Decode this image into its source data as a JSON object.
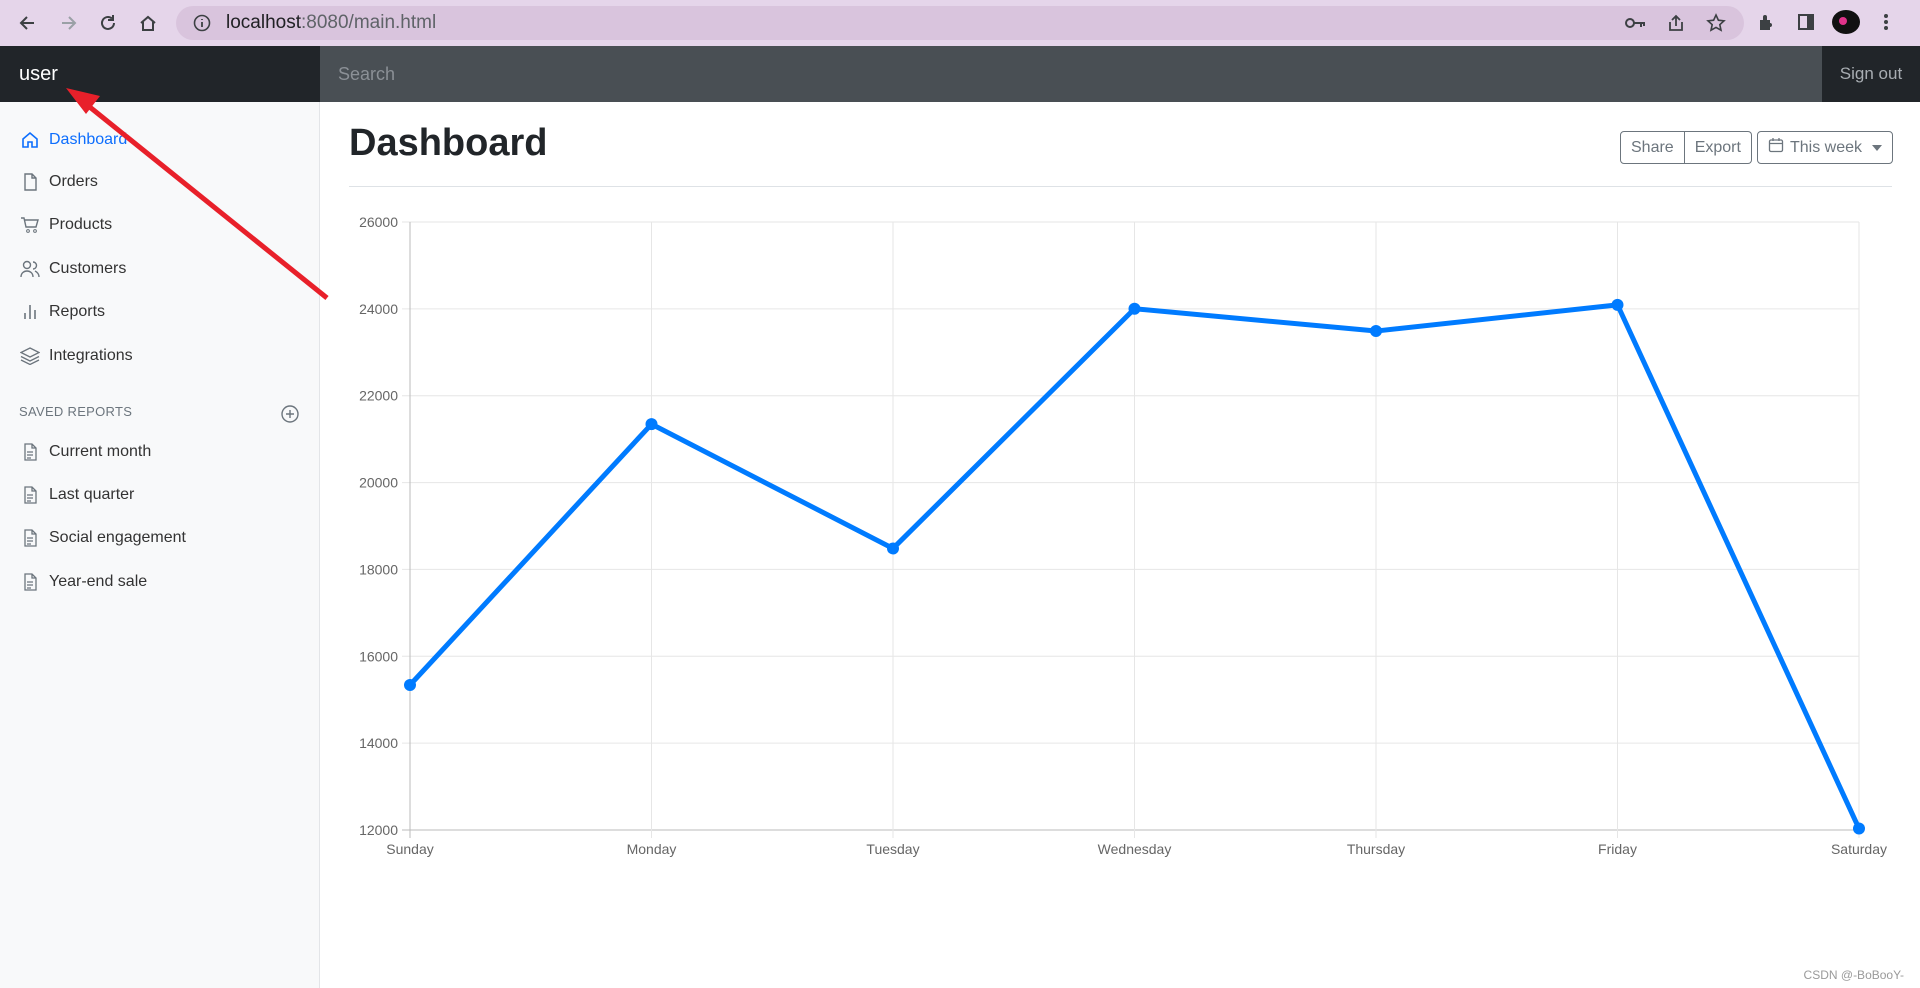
{
  "browser": {
    "url_host": "localhost",
    "url_path": ":8080/main.html"
  },
  "navbar": {
    "brand": "user",
    "search_placeholder": "Search",
    "signout": "Sign out"
  },
  "sidebar": {
    "items": [
      {
        "label": "Dashboard",
        "icon": "home-icon",
        "active": true
      },
      {
        "label": "Orders",
        "icon": "file-icon"
      },
      {
        "label": "Products",
        "icon": "cart-icon"
      },
      {
        "label": "Customers",
        "icon": "users-icon"
      },
      {
        "label": "Reports",
        "icon": "bar-chart-icon"
      },
      {
        "label": "Integrations",
        "icon": "layers-icon"
      }
    ],
    "saved_heading": "SAVED REPORTS",
    "saved": [
      {
        "label": "Current month",
        "icon": "file-text-icon"
      },
      {
        "label": "Last quarter",
        "icon": "file-text-icon"
      },
      {
        "label": "Social engagement",
        "icon": "file-text-icon"
      },
      {
        "label": "Year-end sale",
        "icon": "file-text-icon"
      }
    ]
  },
  "main": {
    "title": "Dashboard",
    "share": "Share",
    "export": "Export",
    "period": "This week"
  },
  "chart_data": {
    "type": "line",
    "categories": [
      "Sunday",
      "Monday",
      "Tuesday",
      "Wednesday",
      "Thursday",
      "Friday",
      "Saturday"
    ],
    "series": [
      {
        "values": [
          15339,
          21345,
          18483,
          24003,
          23489,
          24092,
          12034
        ],
        "color": "#007bff"
      }
    ],
    "yticks": [
      12000,
      14000,
      16000,
      18000,
      20000,
      22000,
      24000,
      26000
    ],
    "ylim": [
      12000,
      26000
    ],
    "grid": true
  },
  "watermark": "CSDN @-BoBooY-",
  "colors": {
    "accent": "#0d6efd",
    "line": "#007bff",
    "navbar": "#212529"
  }
}
